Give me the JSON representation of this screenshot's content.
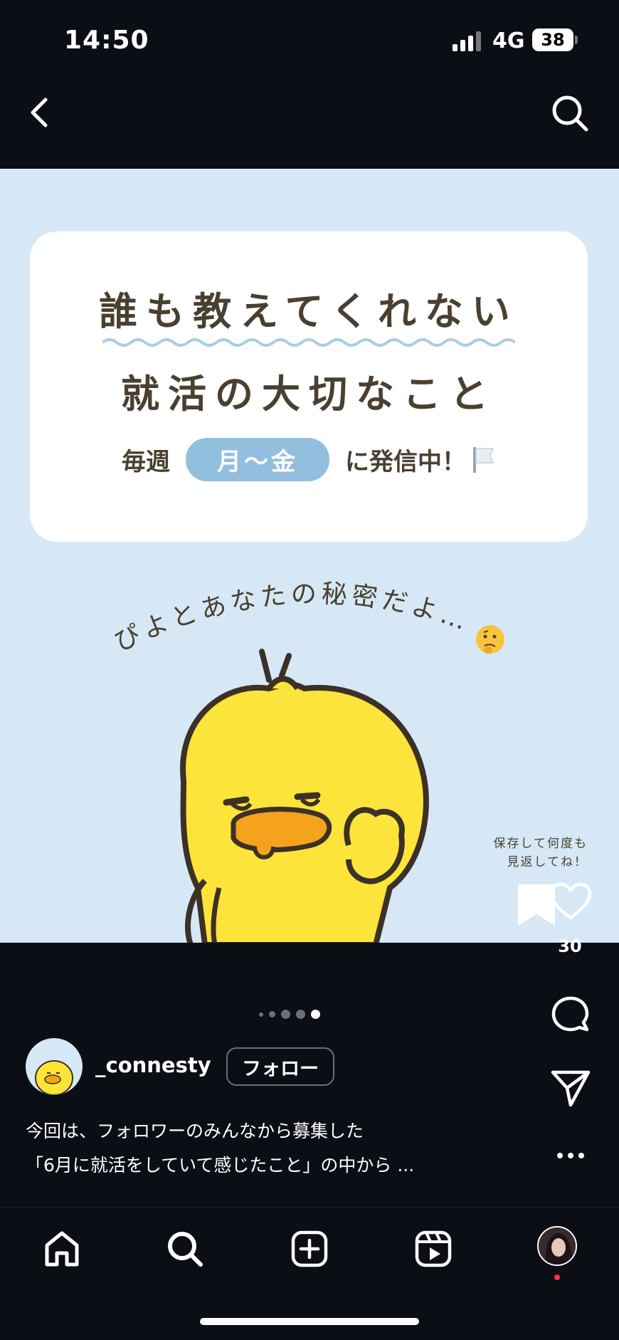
{
  "status_bar": {
    "time": "14:50",
    "network": "4G",
    "battery": "38"
  },
  "header": {
    "back_icon": "chevron-left-icon",
    "search_icon": "search-icon"
  },
  "post": {
    "title_line1": "誰も教えてくれない",
    "title_line2": "就活の大切なこと",
    "schedule_prefix": "毎週",
    "schedule_days": "月〜金",
    "schedule_suffix": "に発信中！",
    "arc_text": "ぴよとあなたの秘密だよ…",
    "save_note_line1": "保存して何度も",
    "save_note_line2": "見返してね！",
    "like_count": "30",
    "carousel": {
      "total": 5,
      "active": 5
    }
  },
  "author": {
    "username": "_connesty",
    "follow_label": "フォロー"
  },
  "caption": {
    "line1": "今回は、フォロワーのみんなから募集した",
    "line2": "「6月に就活をしていて感じたこと」の中から ..."
  },
  "tabbar": {
    "items": [
      "home-icon",
      "search-icon",
      "create-icon",
      "reels-icon",
      "profile-avatar"
    ]
  },
  "colors": {
    "background": "#0b0e14",
    "media_bg": "#d6e8f5",
    "pill": "#92bfdd",
    "chick": "#fde43a",
    "beak": "#f5a21c",
    "notification_dot": "#ff3040"
  }
}
